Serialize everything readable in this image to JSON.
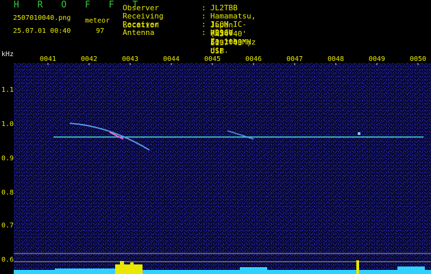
{
  "logo": "H R O F F T",
  "file_name": "2507010040.png",
  "timestamp": "25.07.01 00:40",
  "meteor_label": "meteor",
  "meteor_count": "97",
  "header": [
    {
      "key": "Observer",
      "sep": ":",
      "value": "JL2TBB"
    },
    {
      "key": "Receiving Location",
      "sep": ":",
      "value": "Hamamatsu, Japan (N34°40' E137°43')"
    },
    {
      "key": "Receiver",
      "sep": ":",
      "value": "ICOM IC-R2500 53.1000MHz USB"
    },
    {
      "key": "Antenna",
      "sep": ":",
      "value": "HB9CV Zenith dir."
    }
  ],
  "y_unit": "kHz",
  "time_ticks": [
    "0041",
    "0042",
    "0043",
    "0044",
    "0045",
    "0046",
    "0047",
    "0048",
    "0049",
    "0050"
  ],
  "freq_ticks": [
    "1.1",
    "1.0",
    "0.9",
    "0.8",
    "0.7",
    "0.6"
  ],
  "colors": {
    "text_yellow": "#e8e800",
    "logo_green": "#33cc33",
    "label_white": "#e6e6e6",
    "background": "#000000",
    "noise_blue": "#1a1a90",
    "carrier_line": "#40e0d0",
    "level_bars": "#30d0ff",
    "level_peaks": "#e8e800"
  }
}
